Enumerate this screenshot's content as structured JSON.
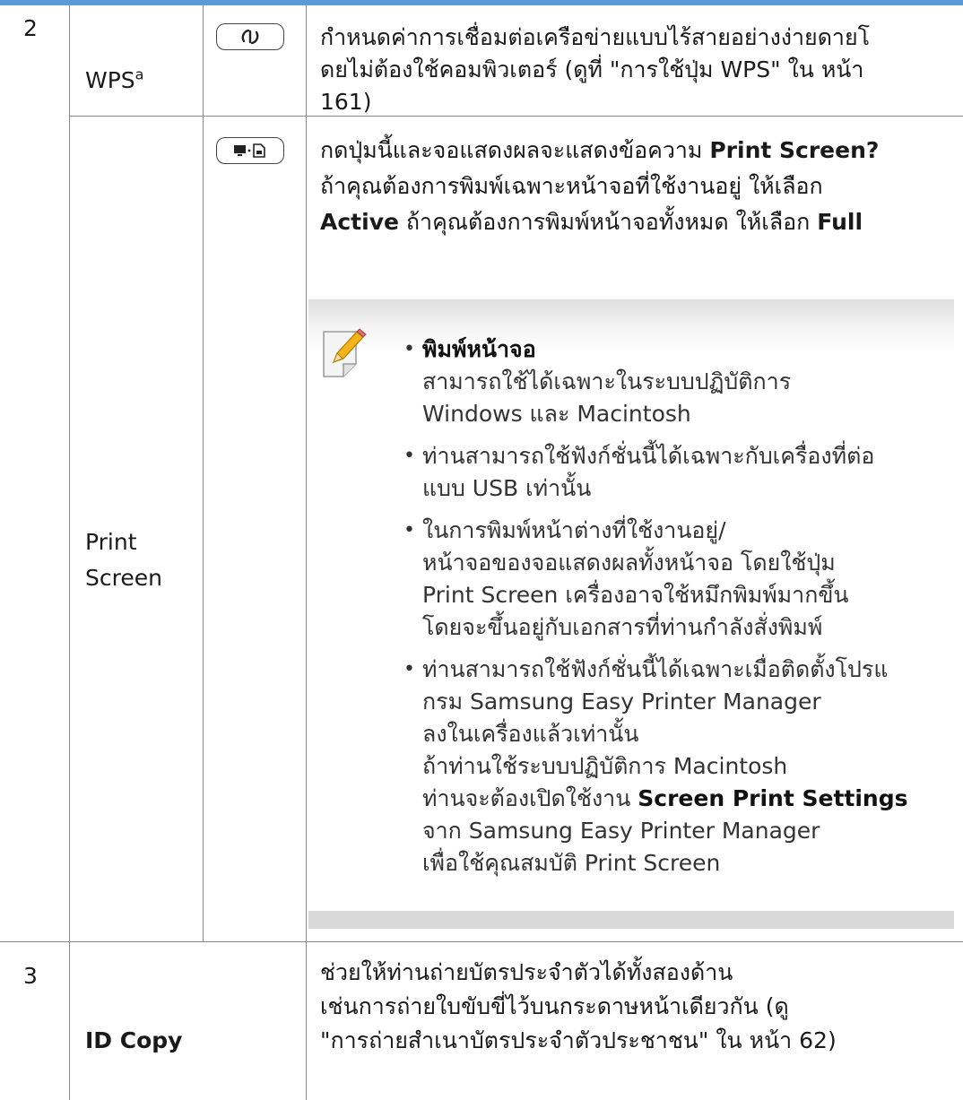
{
  "rows": {
    "r2": {
      "num": "2",
      "wps": {
        "label": "WPS",
        "sup": "a",
        "desc": [
          "กำหนดค่าการเชื่อมต่อเครือข่ายแบบไร้สายอย่างง่ายดายโ",
          "ดยไม่ต้องใช้คอมพิวเตอร์ (ดูที่ \"การใช้ปุ่ม WPS\"  ใน  หน้า",
          "161)"
        ]
      },
      "print_screen": {
        "label_line1": "Print",
        "label_line2": "Screen",
        "desc_l1_a": "กดปุ่มนี้และจอแสดงผลจะแสดงข้อความ ",
        "desc_l1_b": "Print Screen?",
        "desc_l2": "ถ้าคุณต้องการพิมพ์เฉพาะหน้าจอที่ใช้งานอยู่ ให้เลือก",
        "desc_l3_a": "Active",
        "desc_l3_b": " ถ้าคุณต้องการพิมพ์หน้าจอทั้งหมด ให้เลือก ",
        "desc_l3_c": "Full"
      }
    },
    "r3": {
      "num": "3",
      "label": "ID Copy",
      "desc": [
        "ช่วยให้ท่านถ่ายบัตรประจำตัวได้ทั้งสองด้าน",
        "เช่นการถ่ายใบขับขี่ไว้บนกระดาษหน้าเดียวกัน (ดู",
        "\"การถ่ายสำเนาบัตรประจำตัวประชาชน\"  ใน  หน้า 62)"
      ]
    }
  },
  "note": {
    "bullet": "•",
    "b1_title": "พิมพ์หน้าจอ",
    "b1_lines": [
      "สามารถใช้ได้เฉพาะในระบบปฏิบัติการ",
      "Windows และ Macintosh"
    ],
    "b2_lines": [
      "ท่านสามารถใช้ฟังก์ชั่นนี้ได้เฉพาะกับเครื่องที่ต่อ",
      "แบบ USB เท่านั้น"
    ],
    "b3_lines": [
      "ในการพิมพ์หน้าต่างที่ใช้งานอยู่/",
      "หน้าจอของจอแสดงผลทั้งหน้าจอ โดยใช้ปุ่ม",
      "Print Screen เครื่องอาจใช้หมึกพิมพ์มากขึ้น",
      "โดยจะขึ้นอยู่กับเอกสารที่ท่านกำลังสั่งพิมพ์"
    ],
    "b4_lines": [
      "ท่านสามารถใช้ฟังก์ชั่นนี้ได้เฉพาะเมื่อติดตั้งโปรแ",
      "กรม Samsung Easy Printer Manager",
      "ลงในเครื่องแล้วเท่านั้น",
      "ถ้าท่านใช้ระบบปฏิบัติการ Macintosh"
    ],
    "b4_l5_a": "ท่านจะต้องเปิดใช้งาน ",
    "b4_l5_b": "Screen Print Settings",
    "b4_l6": "จาก Samsung Easy Printer Manager",
    "b4_l7": "เพื่อใช้คุณสมบัติ Print Screen"
  },
  "colors": {
    "accent": "#5b9bd5",
    "rule": "#8a8a8a",
    "note_bar": "#d9d9d9"
  },
  "icons": {
    "wps_button": "wps-icon",
    "print_screen_button": "print-screen-icon",
    "note": "note-pencil-icon"
  }
}
